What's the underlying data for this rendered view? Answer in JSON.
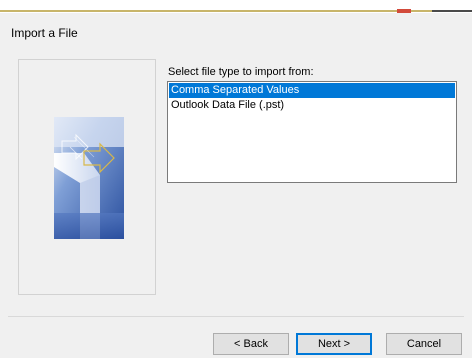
{
  "dialog": {
    "title": "Import a File",
    "prompt": "Select file type to import from:",
    "file_types": [
      {
        "label": "Comma Separated Values",
        "selected": true
      },
      {
        "label": "Outlook Data File (.pst)",
        "selected": false
      }
    ],
    "buttons": {
      "back": "< Back",
      "next": "Next >",
      "cancel": "Cancel"
    }
  },
  "colors": {
    "selection": "#0078d7",
    "dialog_bg": "#f0f0f0",
    "accent_line": "#c8b56a"
  },
  "icons": {
    "wizard_graphic": "import-wizard-graphic-icon"
  }
}
